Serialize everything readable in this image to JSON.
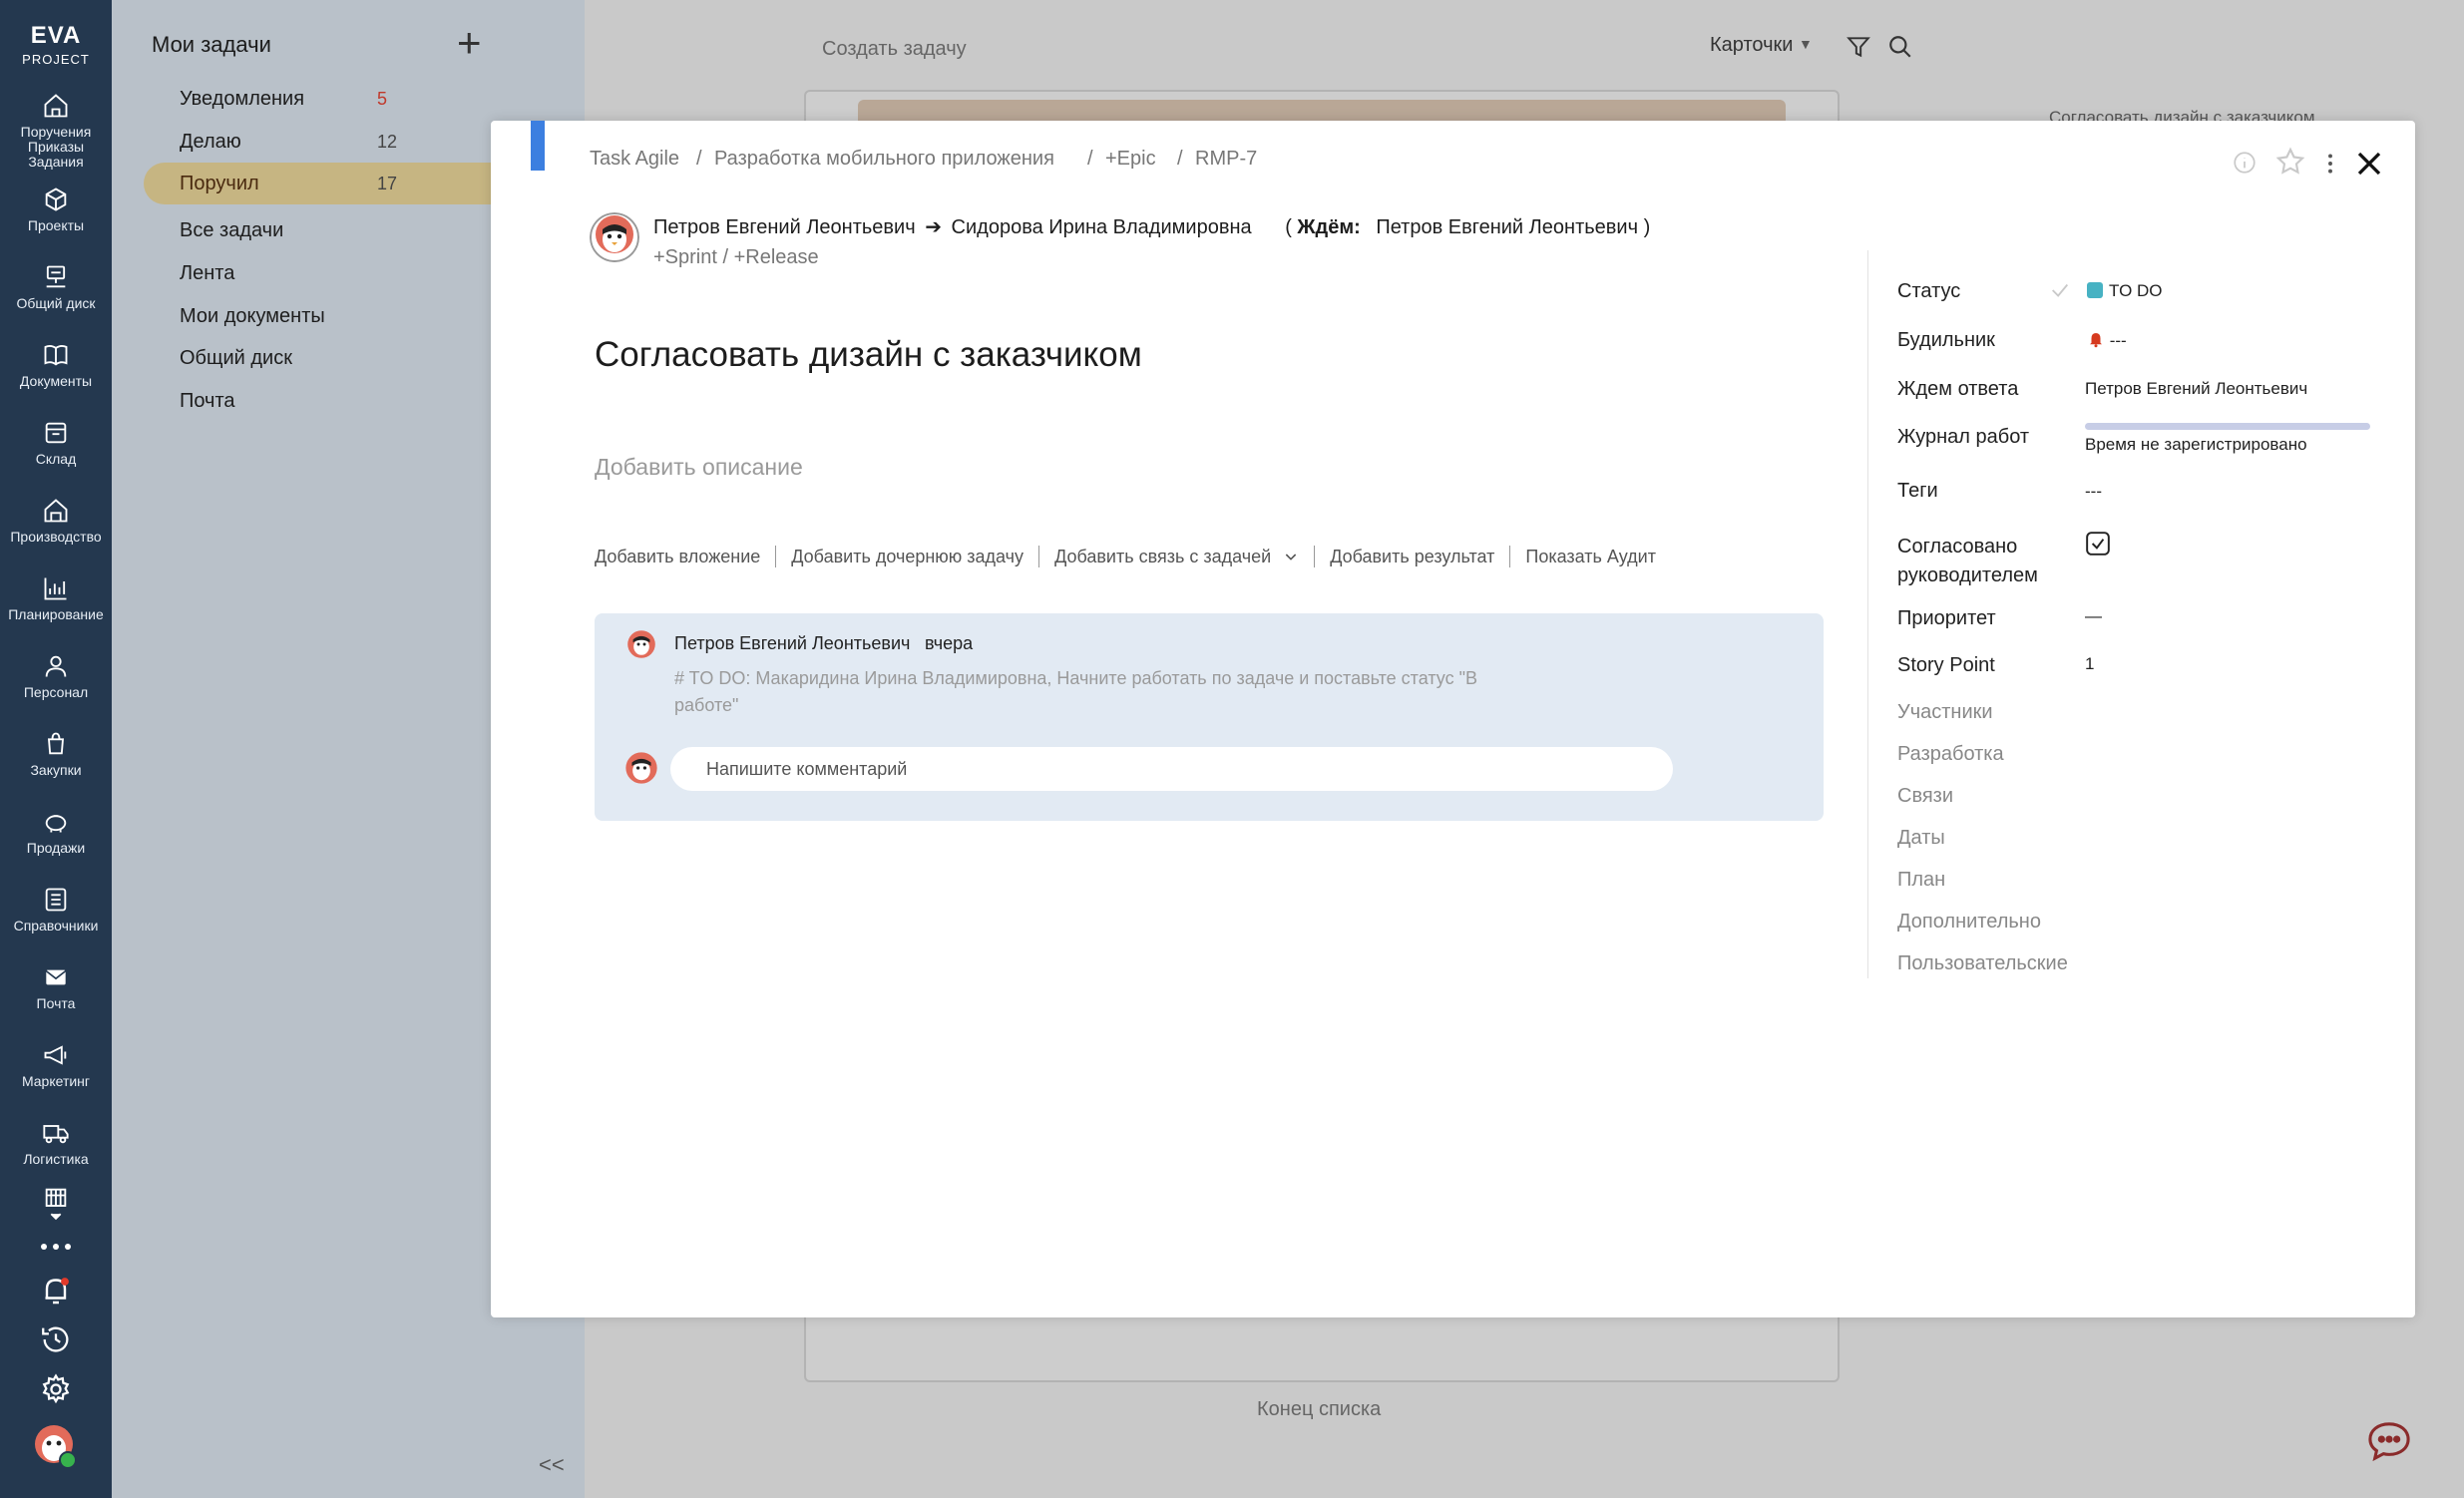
{
  "colors": {
    "sidebar": "#24384f",
    "accent": "#3c7fe0",
    "active_item": "#c6b582",
    "status": "#47b2c3",
    "danger": "#d63a1f"
  },
  "app": {
    "logo_main": "EVA",
    "logo_sub": "PROJECT"
  },
  "sidebar": {
    "items": [
      {
        "label": "Поручения Приказы Задания",
        "icon": "home-icon"
      },
      {
        "label": "Проекты",
        "icon": "cube-icon"
      },
      {
        "label": "Общий диск",
        "icon": "server-icon"
      },
      {
        "label": "Документы",
        "icon": "book-icon"
      },
      {
        "label": "Склад",
        "icon": "warehouse-icon"
      },
      {
        "label": "Производство",
        "icon": "factory-icon"
      },
      {
        "label": "Планирование",
        "icon": "chart-icon"
      },
      {
        "label": "Персонал",
        "icon": "person-icon"
      },
      {
        "label": "Закупки",
        "icon": "cart-icon"
      },
      {
        "label": "Продажи",
        "icon": "piggy-bank-icon"
      },
      {
        "label": "Справочники",
        "icon": "list-icon"
      },
      {
        "label": "Почта",
        "icon": "mail-icon"
      },
      {
        "label": "Маркетинг",
        "icon": "megaphone-icon"
      },
      {
        "label": "Логистика",
        "icon": "truck-icon"
      }
    ]
  },
  "tasknav": {
    "title": "Мои задачи",
    "items": [
      {
        "label": "Уведомления",
        "count": "5"
      },
      {
        "label": "Делаю",
        "count": "12"
      },
      {
        "label": "Поручил",
        "count": "17"
      },
      {
        "label": "Все задачи"
      },
      {
        "label": "Лента"
      },
      {
        "label": "Мои документы"
      },
      {
        "label": "Общий диск"
      },
      {
        "label": "Почта"
      }
    ],
    "collapse_label": "<<"
  },
  "main": {
    "create_placeholder": "Создать задачу",
    "view_mode": "Карточки",
    "bg_task_title": "Согласовать дизайн с заказчиком",
    "end_of_list": "Конец списка"
  },
  "modal": {
    "breadcrumb": [
      "Task Agile",
      "/",
      "Разработка мобильного приложения",
      "/",
      "+Epic",
      "/",
      "RMP-7"
    ],
    "people": {
      "from": "Петров Евгений Леонтьевич",
      "arrow": "➔",
      "to": "Сидорова Ирина Владимировна",
      "wait_open": "(",
      "wait_label": "Ждём:",
      "wait_person": "Петров Евгений Леонтьевич",
      "wait_close": ")"
    },
    "sprint_release": "+Sprint / +Release",
    "title": "Согласовать дизайн с заказчиком",
    "description_placeholder": "Добавить описание",
    "actions": [
      "Добавить вложение",
      "Добавить дочернюю задачу",
      "Добавить связь с задачей",
      "Добавить результат",
      "Показать Аудит"
    ],
    "comment": {
      "author": "Петров Евгений Леонтьевич",
      "time": "вчера",
      "text": "# TO DO: Макаридина Ирина Владимировна, Начните работать по задаче и поставьте статус \"В работе\""
    },
    "comment_placeholder": "Напишите комментарий",
    "fields": {
      "status_label": "Статус",
      "status_value": "TO DO",
      "alarm_label": "Будильник",
      "alarm_value": "---",
      "wait_label": "Ждем ответа",
      "wait_value": "Петров Евгений Леонтьевич",
      "worklog_label": "Журнал работ",
      "worklog_value": "Время не зарегистрировано",
      "tags_label": "Теги",
      "tags_value": "---",
      "approved_label": "Согласовано руководителем",
      "approved_checked": true,
      "priority_label": "Приоритет",
      "priority_value": "—",
      "sp_label": "Story Point",
      "sp_value": "1"
    },
    "sections": [
      "Участники",
      "Разработка",
      "Связи",
      "Даты",
      "План",
      "Дополнительно",
      "Пользовательские"
    ]
  }
}
